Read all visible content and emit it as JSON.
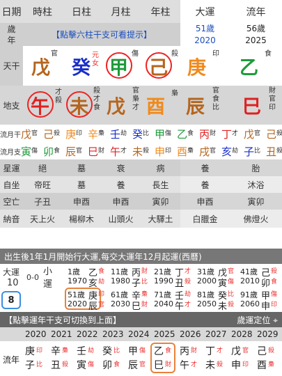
{
  "header": {
    "cols": [
      "日期",
      "時柱",
      "日柱",
      "月柱",
      "年柱",
      "大運",
      "流年"
    ]
  },
  "age_row": {
    "label": "歲\n年",
    "hint": "【點擊六柱干支可看提示】",
    "dayun_age": "51歲",
    "dayun_year": "2020",
    "liunian_age": "56歲",
    "liunian_year": "2025"
  },
  "sky": {
    "label": "天干",
    "items": [
      {
        "char": "戊",
        "color": "#b5651d",
        "tag": "官",
        "tag_color": "#333"
      },
      {
        "char": "癸",
        "color": "#1a2ec9",
        "tag": "元\n女",
        "tag_color": "#e33"
      },
      {
        "char": "甲",
        "color": "#1e9a3a",
        "tag": "傷",
        "tag_color": "#333"
      },
      {
        "char": "己",
        "color": "#b5651d",
        "tag": "殺",
        "tag_color": "#333"
      },
      {
        "char": "庚",
        "color": "#f08a1c",
        "tag": "印",
        "tag_color": "#333"
      },
      {
        "char": "乙",
        "color": "#1e9a3a",
        "tag": "食",
        "tag_color": "#333"
      }
    ]
  },
  "earth": {
    "label": "地支",
    "items": [
      {
        "char": "午",
        "color": "#e02020",
        "tag": "才\n殺"
      },
      {
        "char": "未",
        "color": "#b5651d",
        "tag": "殺\n才\n食"
      },
      {
        "char": "戊",
        "color": "#b5651d",
        "tag": "官\n梟\n才"
      },
      {
        "char": "酉",
        "color": "#f08a1c",
        "tag": "梟"
      },
      {
        "char": "辰",
        "color": "#b5651d",
        "tag": "官\n食\n比"
      },
      {
        "char": "巳",
        "color": "#e02020",
        "tag": "財\n官\n印"
      }
    ]
  },
  "liuyue_gan": {
    "label": "流月干",
    "items": [
      {
        "c": "戊",
        "col": "#b5651d",
        "t": "官"
      },
      {
        "c": "己",
        "col": "#b5651d",
        "t": "殺"
      },
      {
        "c": "庚",
        "col": "#f08a1c",
        "t": "印"
      },
      {
        "c": "辛",
        "col": "#f08a1c",
        "t": "梟"
      },
      {
        "c": "壬",
        "col": "#1a2ec9",
        "t": "劫"
      },
      {
        "c": "癸",
        "col": "#1a2ec9",
        "t": "比"
      },
      {
        "c": "甲",
        "col": "#1e9a3a",
        "t": "傷"
      },
      {
        "c": "乙",
        "col": "#1e9a3a",
        "t": "食"
      },
      {
        "c": "丙",
        "col": "#e02020",
        "t": "財"
      },
      {
        "c": "丁",
        "col": "#e02020",
        "t": "才"
      },
      {
        "c": "戊",
        "col": "#b5651d",
        "t": "官"
      },
      {
        "c": "己",
        "col": "#b5651d",
        "t": "殺"
      }
    ]
  },
  "liuyue_zhi": {
    "label": "流月支",
    "items": [
      {
        "c": "寅",
        "col": "#1e9a3a",
        "t": "傷"
      },
      {
        "c": "卯",
        "col": "#1e9a3a",
        "t": "食"
      },
      {
        "c": "辰",
        "col": "#b5651d",
        "t": "官"
      },
      {
        "c": "巳",
        "col": "#e02020",
        "t": "財"
      },
      {
        "c": "午",
        "col": "#e02020",
        "t": "才"
      },
      {
        "c": "未",
        "col": "#b5651d",
        "t": "殺"
      },
      {
        "c": "申",
        "col": "#f08a1c",
        "t": "印"
      },
      {
        "c": "酉",
        "col": "#f08a1c",
        "t": "梟"
      },
      {
        "c": "戌",
        "col": "#b5651d",
        "t": "官"
      },
      {
        "c": "亥",
        "col": "#1a2ec9",
        "t": "劫"
      },
      {
        "c": "子",
        "col": "#1a2ec9",
        "t": "比"
      },
      {
        "c": "丑",
        "col": "#b5651d",
        "t": "殺"
      }
    ]
  },
  "rows": [
    {
      "label": "星運",
      "vals": [
        "絕",
        "墓",
        "衰",
        "病",
        "養",
        "胎"
      ]
    },
    {
      "label": "自坐",
      "vals": [
        "帝旺",
        "墓",
        "養",
        "長生",
        "養",
        "沐浴"
      ]
    },
    {
      "label": "空亡",
      "vals": [
        "子丑",
        "申酉",
        "申酉",
        "寅卯",
        "申酉",
        "寅卯"
      ]
    },
    {
      "label": "納音",
      "vals": [
        "天上火",
        "楊柳木",
        "山頭火",
        "大驛土",
        "白臘金",
        "佛燈火"
      ]
    }
  ],
  "banner": "出生後1年1月開始行大運,每交大運年12月起運(西曆)",
  "dayun": {
    "label_top": "大運",
    "age_start": "10",
    "zero": "0-0",
    "xiao": "小\n運",
    "current": "8",
    "top": [
      {
        "age": "1歲",
        "year": "1970",
        "g": "乙",
        "gt": "食",
        "z": "亥",
        "zt": "劫"
      },
      {
        "age": "11歲",
        "year": "1980",
        "g": "丙",
        "gt": "財",
        "z": "子",
        "zt": "比"
      },
      {
        "age": "21歲",
        "year": "1990",
        "g": "丁",
        "gt": "才",
        "z": "丑",
        "zt": "殺"
      },
      {
        "age": "31歲",
        "year": "2000",
        "g": "戊",
        "gt": "官",
        "z": "寅",
        "zt": "傷"
      },
      {
        "age": "41歲",
        "year": "2010",
        "g": "己",
        "gt": "殺",
        "z": "卯",
        "zt": "食"
      }
    ],
    "bottom": [
      {
        "age": "51歲",
        "year": "2020",
        "g": "庚",
        "gt": "印",
        "z": "辰",
        "zt": "官"
      },
      {
        "age": "61歲",
        "year": "2030",
        "g": "辛",
        "gt": "梟",
        "z": "巳",
        "zt": "財"
      },
      {
        "age": "71歲",
        "year": "2040",
        "g": "壬",
        "gt": "劫",
        "z": "午",
        "zt": "才"
      },
      {
        "age": "81歲",
        "year": "2050",
        "g": "癸",
        "gt": "比",
        "z": "未",
        "zt": "殺"
      },
      {
        "age": "91歲",
        "year": "2060",
        "g": "甲",
        "gt": "傷",
        "z": "申",
        "zt": "印"
      }
    ]
  },
  "banner2": {
    "left": "【點擊運年干支可切換到上面】",
    "right": "歲運定位"
  },
  "liunian": {
    "label": "流年",
    "years": [
      "2020",
      "2021",
      "2022",
      "2023",
      "2024",
      "2025",
      "2026",
      "2027",
      "2028",
      "2029"
    ],
    "items": [
      {
        "g": "庚",
        "gt": "印",
        "z": "子",
        "zt": "比"
      },
      {
        "g": "辛",
        "gt": "梟",
        "z": "丑",
        "zt": "殺"
      },
      {
        "g": "壬",
        "gt": "劫",
        "z": "寅",
        "zt": "傷"
      },
      {
        "g": "癸",
        "gt": "比",
        "z": "卯",
        "zt": "食"
      },
      {
        "g": "甲",
        "gt": "傷",
        "z": "辰",
        "zt": "官"
      },
      {
        "g": "乙",
        "gt": "食",
        "z": "巳",
        "zt": "財"
      },
      {
        "g": "丙",
        "gt": "財",
        "z": "午",
        "zt": "才"
      },
      {
        "g": "丁",
        "gt": "才",
        "z": "未",
        "zt": "殺"
      },
      {
        "g": "戊",
        "gt": "官",
        "z": "申",
        "zt": "印"
      },
      {
        "g": "己",
        "gt": "殺",
        "z": "酉",
        "zt": "梟"
      }
    ]
  }
}
